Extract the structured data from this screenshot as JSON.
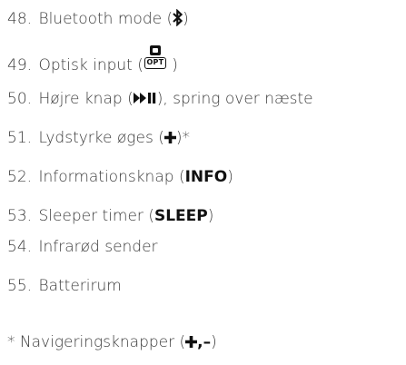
{
  "items": [
    {
      "num": "48.",
      "text": "Bluetooth mode (",
      "symbol": "",
      "suffix": ")"
    },
    {
      "num": "49.",
      "text": "Optisk input (",
      "symbol": "OPT",
      "suffix": " )"
    },
    {
      "num": "50.",
      "text": "Højre knap (",
      "symbol": "",
      "suffix": "), spring over næste"
    },
    {
      "num": "51.",
      "text": "Lydstyrke øges (",
      "symbol": "",
      "suffix": ")*"
    },
    {
      "num": "52.",
      "text": "Informationsknap (",
      "symbol": "INFO",
      "suffix": ")"
    },
    {
      "num": "53.",
      "text": "Sleeper timer (",
      "symbol": "SLEEP",
      "suffix": ")"
    },
    {
      "num": "54.",
      "text": "Infrarød sender",
      "symbol": "",
      "suffix": ""
    },
    {
      "num": "55.",
      "text": "Batterirum",
      "symbol": "",
      "suffix": ""
    }
  ],
  "footnote": {
    "text": "* Navigeringsknapper (",
    "symbol": ",–",
    "suffix": ")"
  }
}
